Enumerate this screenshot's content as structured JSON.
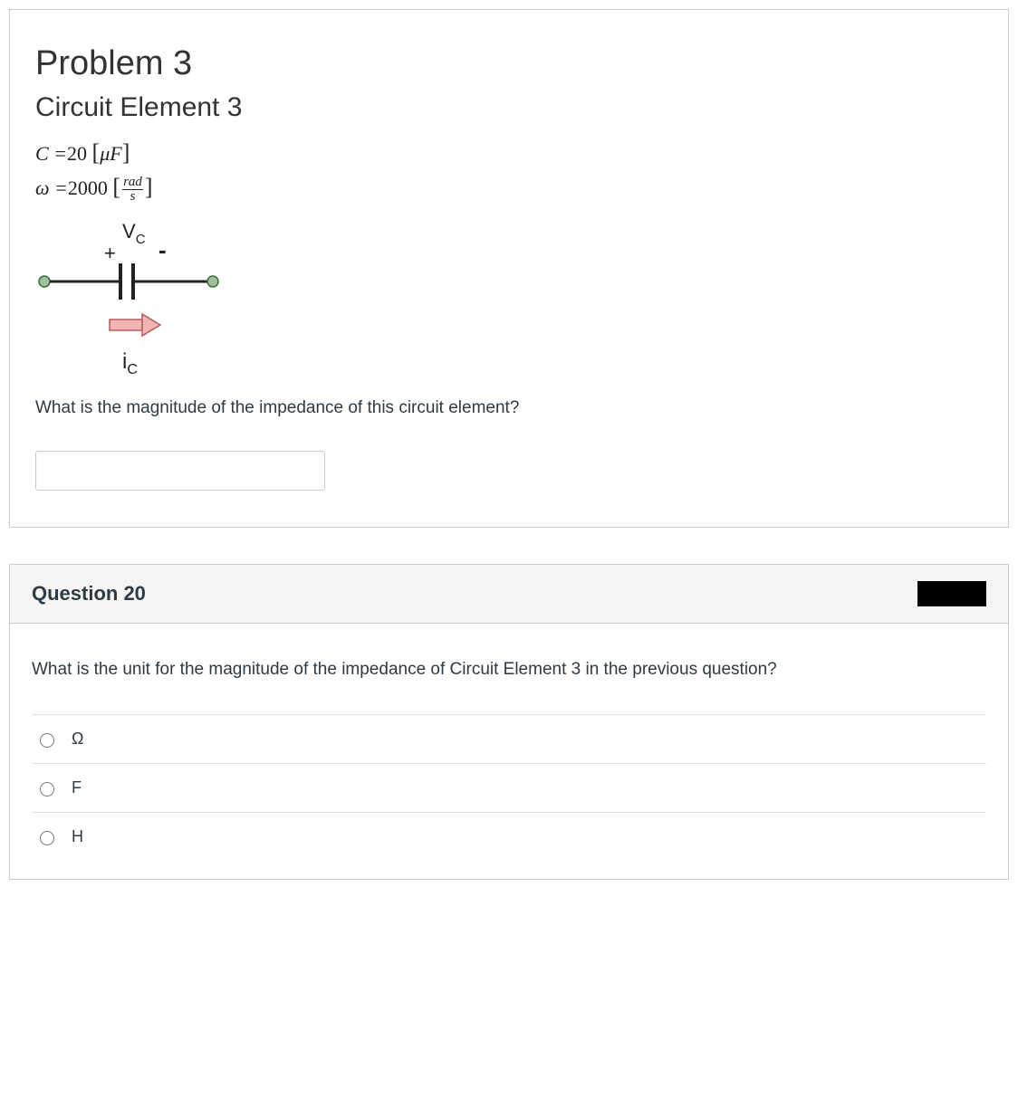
{
  "problem": {
    "title": "Problem 3",
    "subtitle": "Circuit Element 3",
    "c_label": "C =",
    "c_value": "20",
    "c_unit_inner": "μF",
    "w_label": "ω =",
    "w_value": "2000",
    "w_unit_num": "rad",
    "w_unit_den": "s",
    "diagram": {
      "v_label": "V",
      "v_sub": "C",
      "plus": "+",
      "minus": "-",
      "i_label": "i",
      "i_sub": "C"
    },
    "question": "What is the magnitude of the impedance of this circuit element?"
  },
  "q20": {
    "header": "Question 20",
    "text": "What is the unit for the magnitude of the impedance of Circuit Element 3 in the previous question?",
    "options": [
      {
        "label": "Ω"
      },
      {
        "label": "F"
      },
      {
        "label": "H"
      }
    ]
  }
}
